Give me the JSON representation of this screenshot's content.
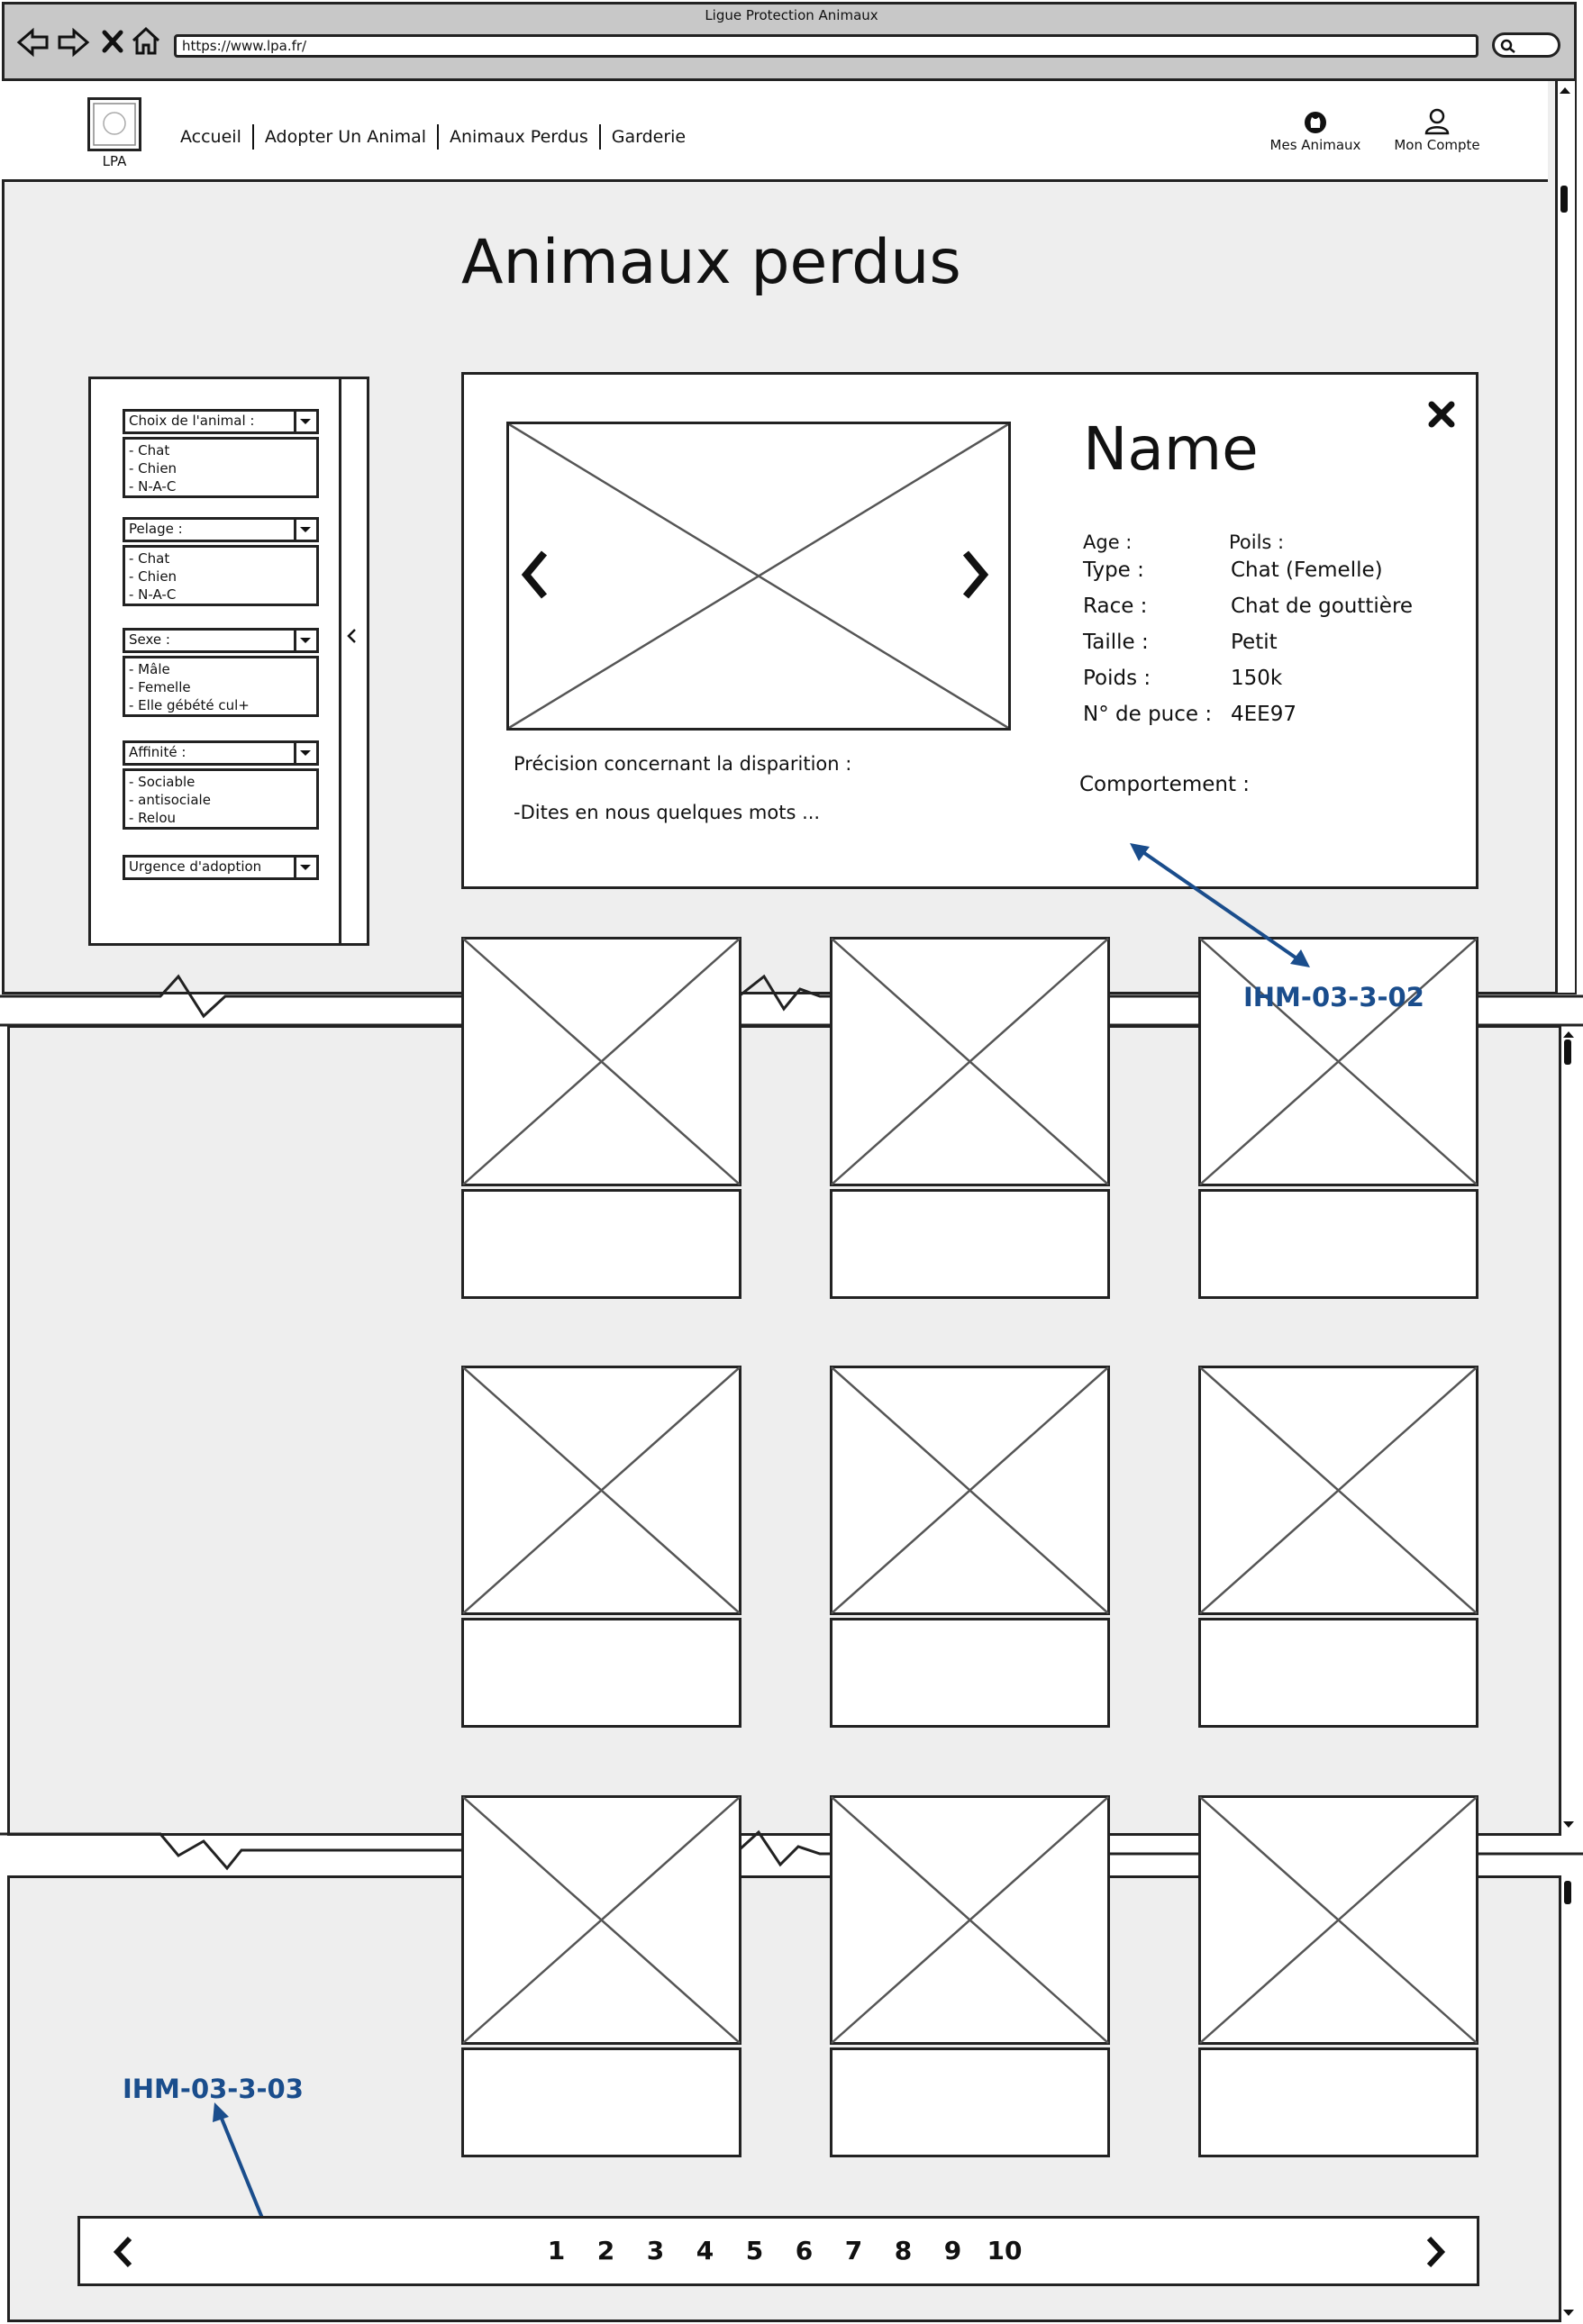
{
  "browser": {
    "window_title": "Ligue Protection Animaux",
    "url": "https://www.lpa.fr/"
  },
  "header": {
    "logo_label": "LPA",
    "nav": [
      "Accueil",
      "Adopter Un Animal",
      "Animaux Perdus",
      "Garderie"
    ],
    "my_pets": "Mes Animaux",
    "my_account": "Mon Compte"
  },
  "page": {
    "title": "Animaux perdus"
  },
  "filters": [
    {
      "label": "Choix de l'animal :",
      "options": [
        "- Chat",
        "- Chien",
        "- N-A-C"
      ]
    },
    {
      "label": "Pelage :",
      "options": [
        "- Chat",
        "- Chien",
        "- N-A-C"
      ]
    },
    {
      "label": "Sexe :",
      "options": [
        "- Mâle",
        "- Femelle",
        "- Elle gébété cul+"
      ]
    },
    {
      "label": "Affinité :",
      "options": [
        "- Sociable",
        "- antisociale",
        "- Relou"
      ]
    },
    {
      "label": "Urgence d'adoption",
      "options": []
    }
  ],
  "detail": {
    "name": "Name",
    "age_label": "Age :",
    "hair_label": "Poils :",
    "type_label": "Type :",
    "type_value": "Chat (Femelle)",
    "race_label": "Race :",
    "race_value": "Chat de gouttière",
    "size_label": "Taille :",
    "size_value": "Petit",
    "weight_label": "Poids :",
    "weight_value": "150k",
    "chip_label": "N° de puce :",
    "chip_value": "4EE97",
    "disappearance_label": "Précision concernant la disparition :",
    "disappearance_text": "-Dites en nous quelques mots ...",
    "behaviour_label": "Comportement :"
  },
  "annotations": {
    "detail": "IHM-03-3-02",
    "pagination": "IHM-03-3-03"
  },
  "pagination": {
    "pages": [
      "1",
      "2",
      "3",
      "4",
      "5",
      "6",
      "7",
      "8",
      "9",
      "10"
    ]
  },
  "colors": {
    "annotation": "#1a4d8c",
    "panel": "#eeeeee",
    "stroke": "#222222"
  }
}
